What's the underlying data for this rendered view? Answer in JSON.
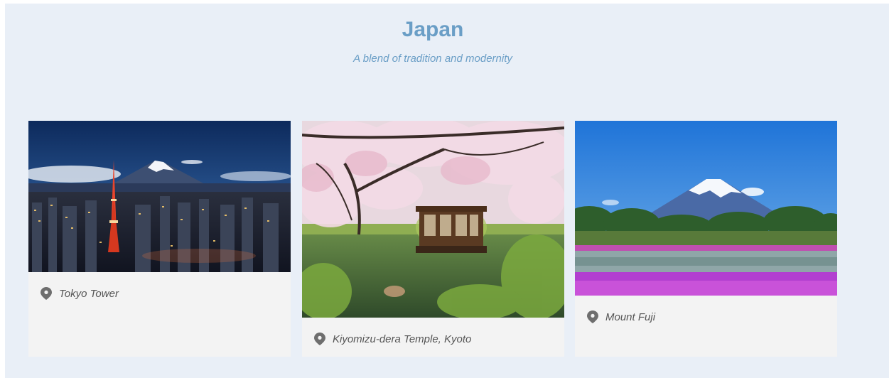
{
  "header": {
    "title": "Japan",
    "subtitle": "A blend of tradition and modernity"
  },
  "cards": [
    {
      "caption": "Tokyo Tower",
      "icon": "location-pin-icon",
      "image": "tokyo-tower-night-skyline"
    },
    {
      "caption": "Kiyomizu-dera Temple, Kyoto",
      "icon": "location-pin-icon",
      "image": "cherry-blossom-boat-canal"
    },
    {
      "caption": "Mount Fuji",
      "icon": "location-pin-icon",
      "image": "mount-fuji-flower-field"
    }
  ],
  "colors": {
    "background": "#e9eff7",
    "accent": "#6a9ec6",
    "card": "#f3f3f3",
    "caption_text": "#555555",
    "pin": "#6e6e6e"
  }
}
